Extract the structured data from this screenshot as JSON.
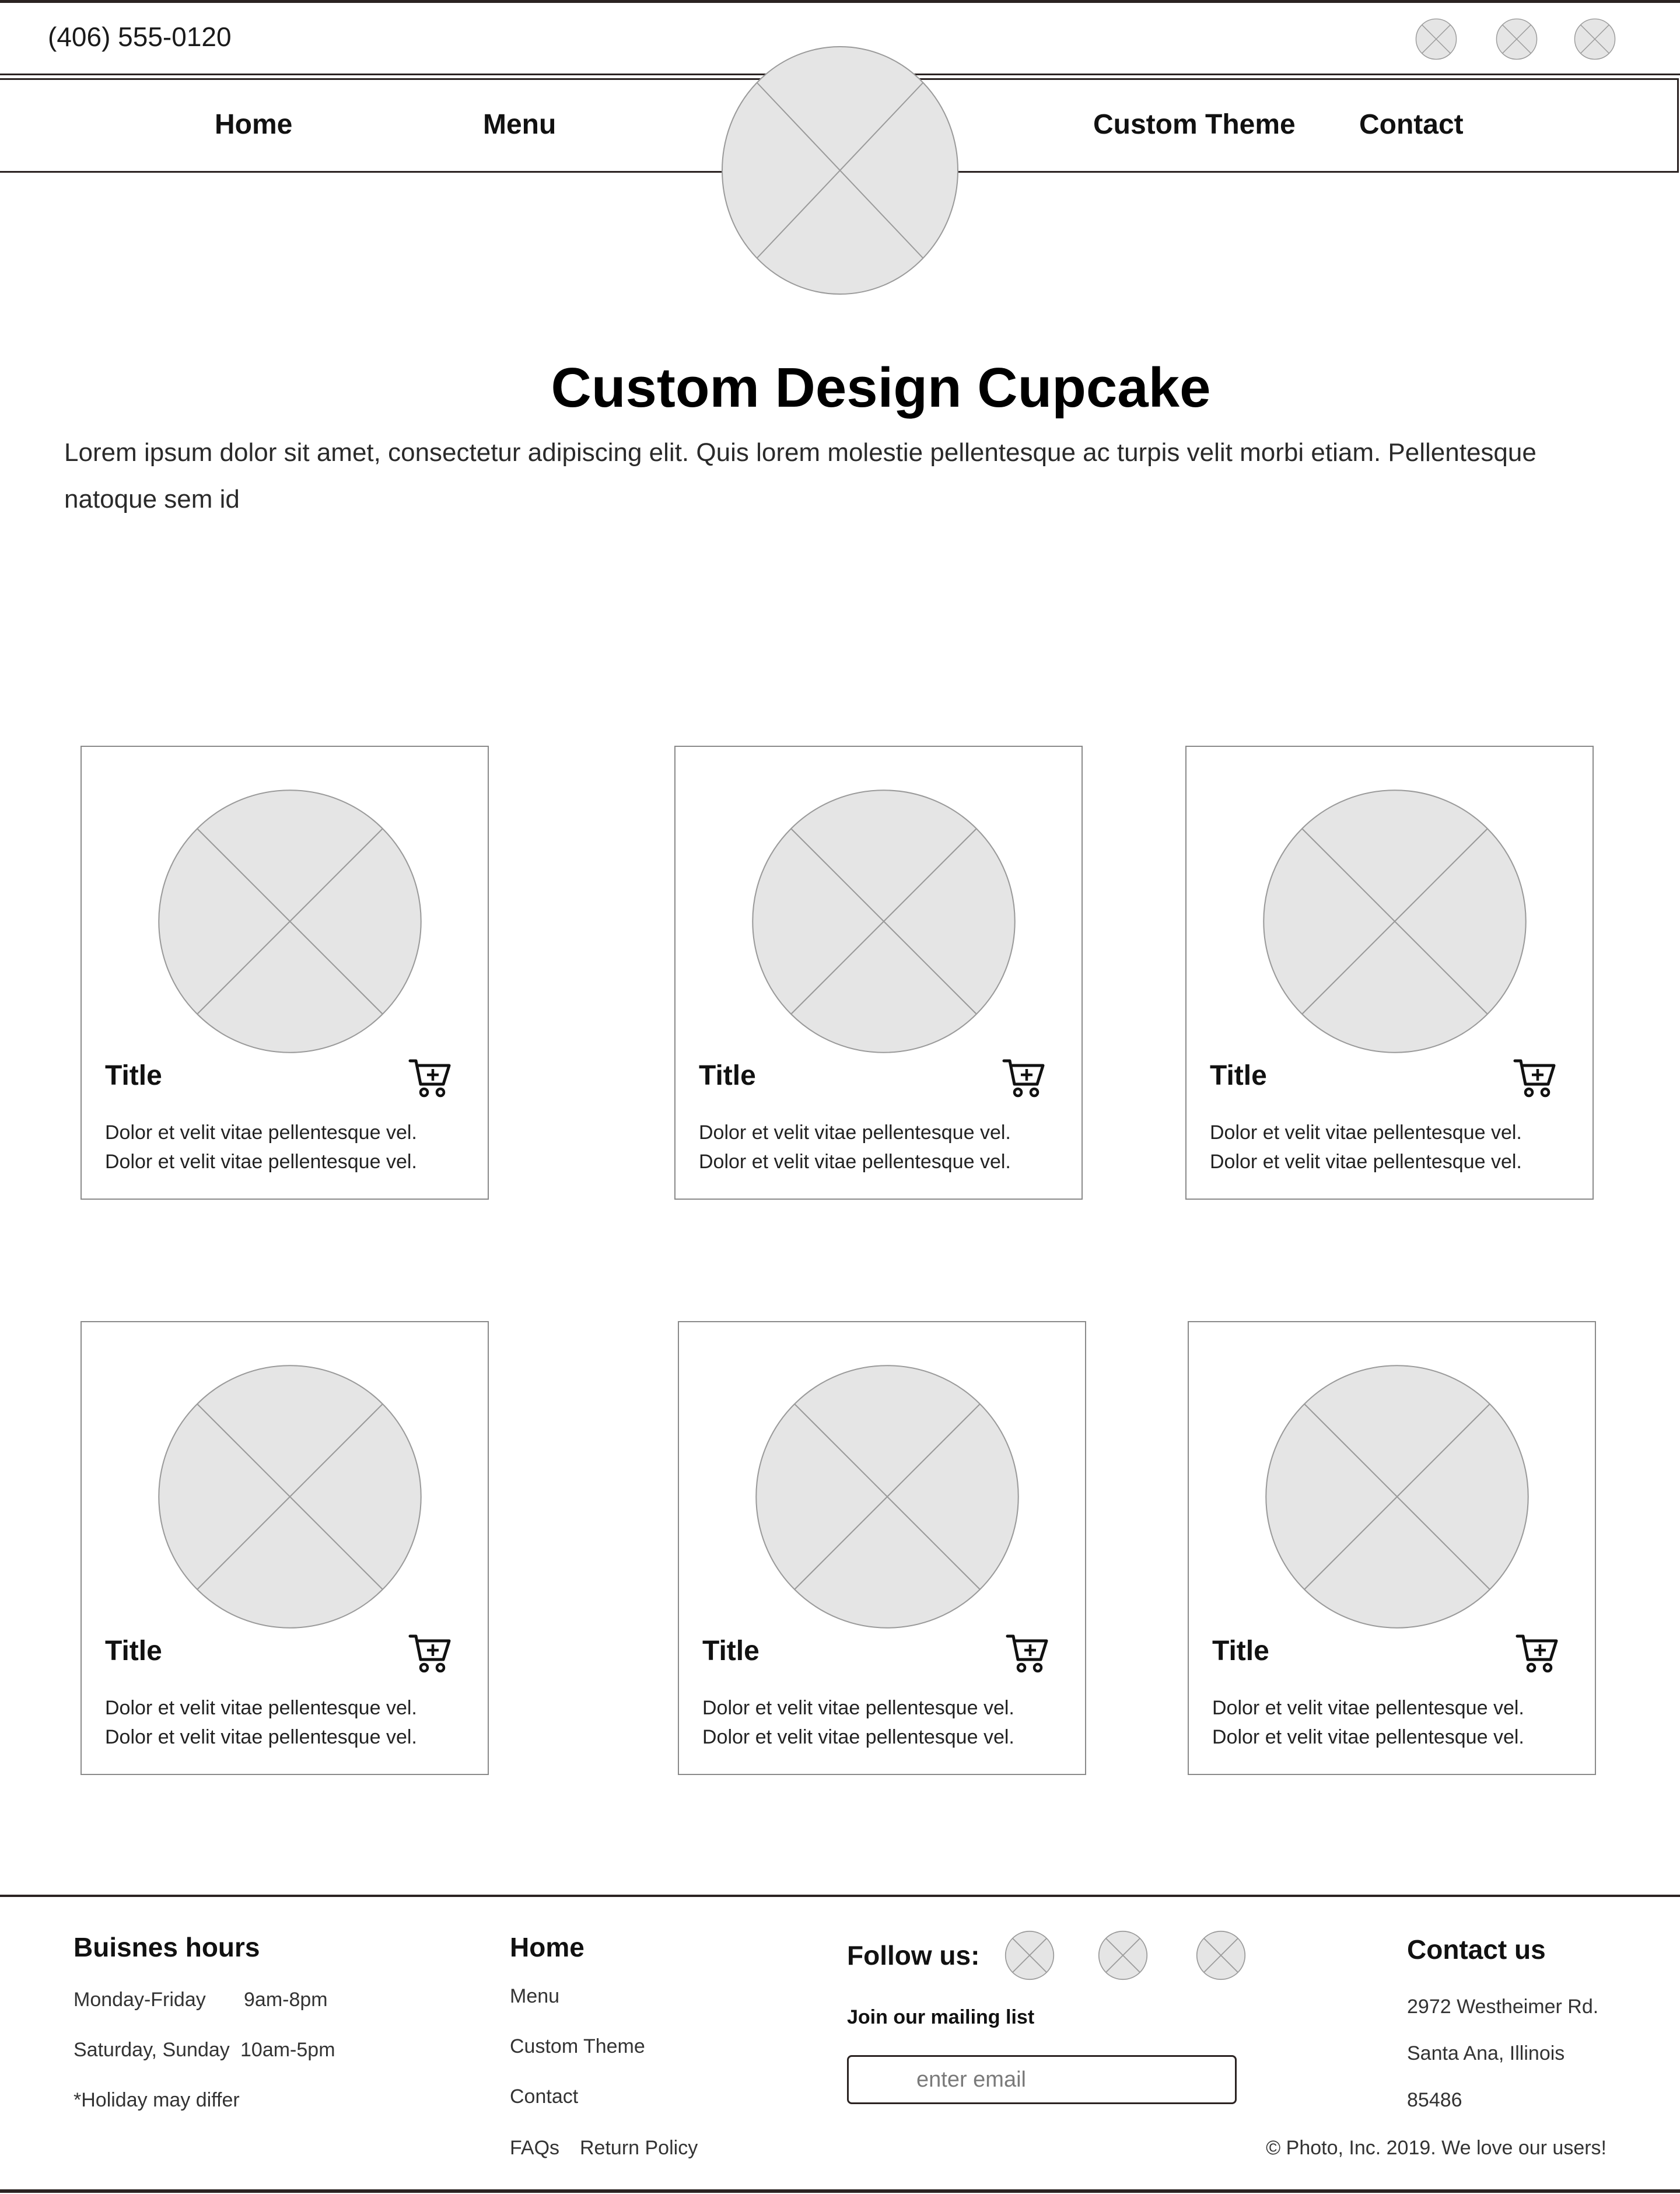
{
  "header": {
    "phone": "(406) 555-0120",
    "social_icons": [
      "social-icon-1",
      "social-icon-2",
      "social-icon-3"
    ]
  },
  "nav": {
    "items": [
      {
        "label": "Home"
      },
      {
        "label": "Menu"
      },
      {
        "label": "Custom Theme"
      },
      {
        "label": "Contact"
      }
    ],
    "logo_icon": "image-placeholder-icon"
  },
  "hero": {
    "title": "Custom Design Cupcake",
    "intro": "Lorem ipsum dolor sit amet, consectetur adipiscing elit. Quis lorem molestie pellentesque ac turpis velit morbi etiam. Pellentesque natoque sem id"
  },
  "products": [
    {
      "title": "Title",
      "desc1": "Dolor et velit vitae pellentesque vel.",
      "desc2": "Dolor et velit vitae pellentesque vel."
    },
    {
      "title": "Title",
      "desc1": "Dolor et velit vitae pellentesque vel.",
      "desc2": "Dolor et velit vitae pellentesque vel."
    },
    {
      "title": "Title",
      "desc1": "Dolor et velit vitae pellentesque vel.",
      "desc2": "Dolor et velit vitae pellentesque vel."
    },
    {
      "title": "Title",
      "desc1": "Dolor et velit vitae pellentesque vel.",
      "desc2": "Dolor et velit vitae pellentesque vel."
    },
    {
      "title": "Title",
      "desc1": "Dolor et velit vitae pellentesque vel.",
      "desc2": "Dolor et velit vitae pellentesque vel."
    },
    {
      "title": "Title",
      "desc1": "Dolor et velit vitae pellentesque vel.",
      "desc2": "Dolor et velit vitae pellentesque vel."
    }
  ],
  "footer": {
    "hours": {
      "heading": "Buisnes hours",
      "weekday_label": "Monday-Friday",
      "weekday_time": "9am-8pm",
      "weekend_label": "Saturday, Sunday",
      "weekend_time": "10am-5pm",
      "note": "*Holiday may differ"
    },
    "links": {
      "heading": "Home",
      "items": [
        "Menu",
        "Custom Theme",
        "Contact",
        "FAQs",
        "Return Policy"
      ]
    },
    "follow": {
      "heading": "Follow us:",
      "mailing_label": "Join our mailing list",
      "email_placeholder": "enter email"
    },
    "contact": {
      "heading": "Contact us",
      "address_line1": "2972 Westheimer Rd.",
      "address_line2": "Santa Ana, Illinois",
      "zip": "85486",
      "copyright": "© Photo, Inc. 2019. We love our users!"
    }
  },
  "colors": {
    "border_dark": "#2b2322",
    "placeholder_fill": "#e5e5e5",
    "placeholder_stroke": "#9a9a9a"
  }
}
